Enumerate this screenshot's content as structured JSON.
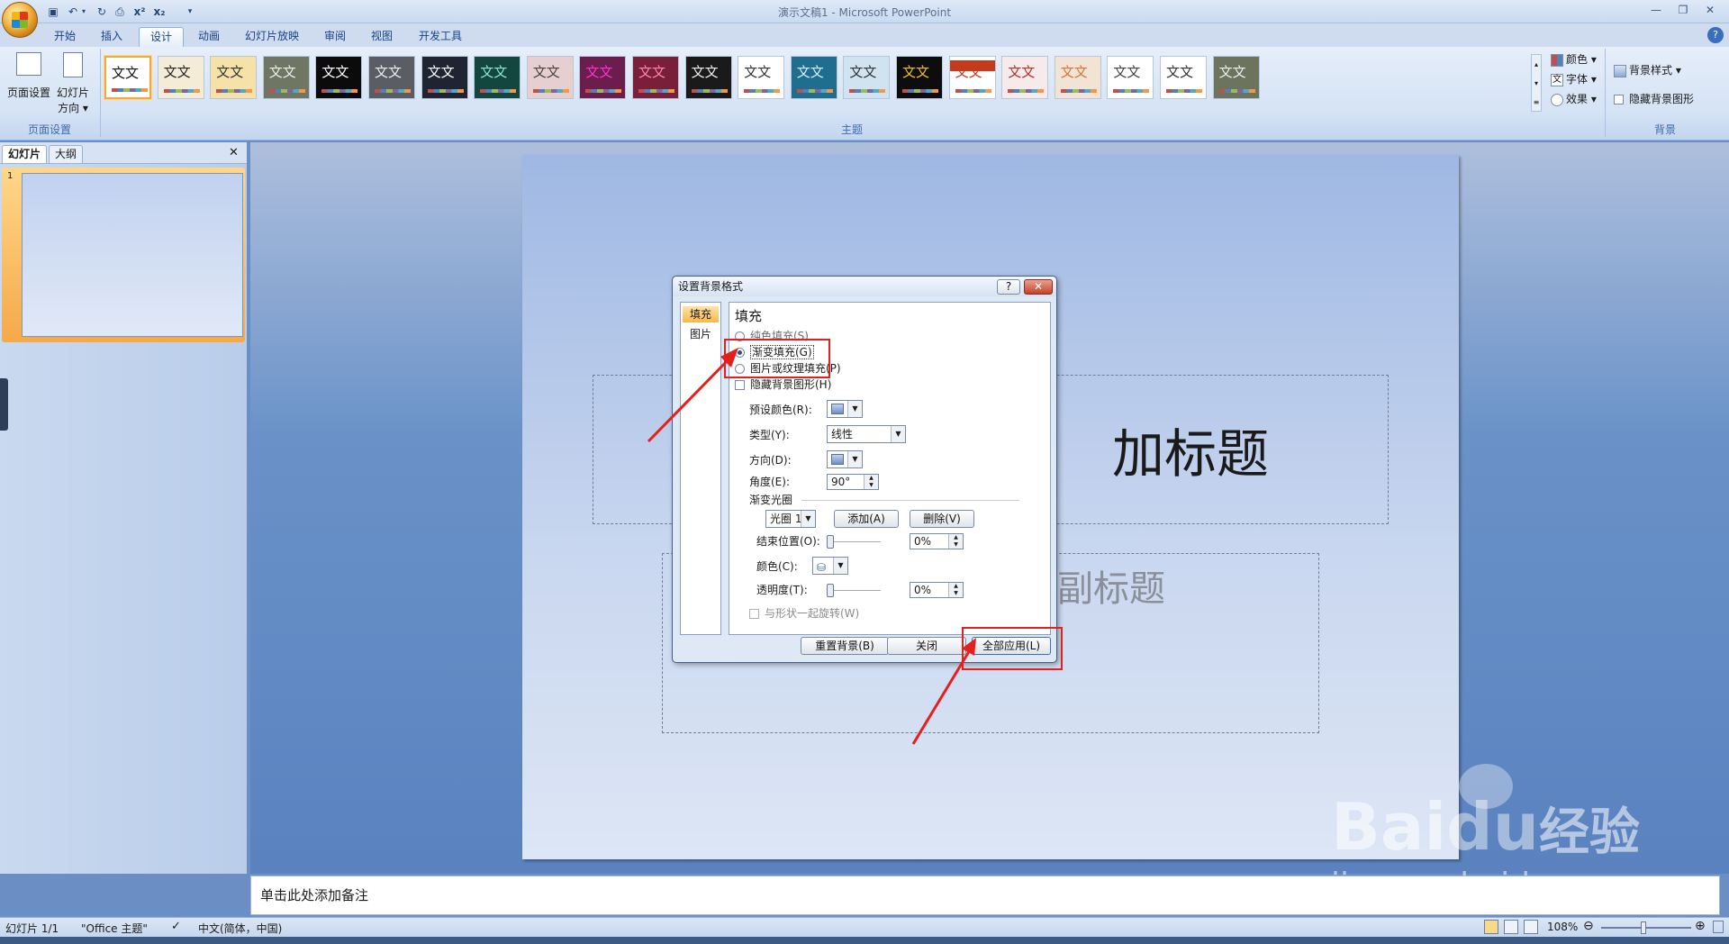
{
  "window": {
    "title": "演示文稿1 - Microsoft PowerPoint"
  },
  "tabs": [
    "开始",
    "插入",
    "设计",
    "动画",
    "幻灯片放映",
    "审阅",
    "视图",
    "开发工具"
  ],
  "ribbon": {
    "page_setup": {
      "btn1": "页面设置",
      "btn2a": "幻灯片",
      "btn2b": "方向 ▾",
      "label": "页面设置"
    },
    "themes": {
      "label": "主题",
      "sample_text": "文文"
    },
    "theme_options": {
      "colors": "颜色 ▾",
      "fonts": "字体 ▾",
      "effects": "效果 ▾"
    },
    "background": {
      "styles": "背景样式 ▾",
      "hide_graphics": "隐藏背景图形",
      "label": "背景"
    }
  },
  "left_pane": {
    "tab_slides": "幻灯片",
    "tab_outline": "大纲",
    "close": "✕",
    "slide_number": "1"
  },
  "slide": {
    "title_partial": "加标题",
    "subtitle_partial": "副标题"
  },
  "notes": {
    "placeholder": "单击此处添加备注"
  },
  "status": {
    "slide": "幻灯片 1/1",
    "theme": "\"Office 主题\"",
    "language": "中文(简体，中国)",
    "zoom": "108%"
  },
  "dialog": {
    "title": "设置背景格式",
    "help": "?",
    "close": "✕",
    "nav": [
      "填充",
      "图片"
    ],
    "section": "填充",
    "options": {
      "solid": "纯色填充(S)",
      "gradient": "渐变填充(G)",
      "picture": "图片或纹理填充(P)",
      "hide": "隐藏背景图形(H)"
    },
    "preset_label": "预设颜色(R):",
    "type_label": "类型(Y):",
    "type_value": "线性",
    "direction_label": "方向(D):",
    "angle_label": "角度(E):",
    "angle_value": "90°",
    "stops_label": "渐变光圈",
    "stop_value": "光圈 1",
    "add_btn": "添加(A)",
    "delete_btn": "删除(V)",
    "end_pos_label": "结束位置(O):",
    "end_pos_value": "0%",
    "color_label": "颜色(C):",
    "transparency_label": "透明度(T):",
    "transparency_value": "0%",
    "rotate_label": "与形状一起旋转(W)",
    "reset_btn": "重置背景(B)",
    "close_btn": "关闭",
    "apply_all_btn": "全部应用(L)"
  },
  "watermark": {
    "brand": "Bai",
    "brand2": "du",
    "suffix": "经验",
    "url": "jingyan.baidu.com"
  }
}
